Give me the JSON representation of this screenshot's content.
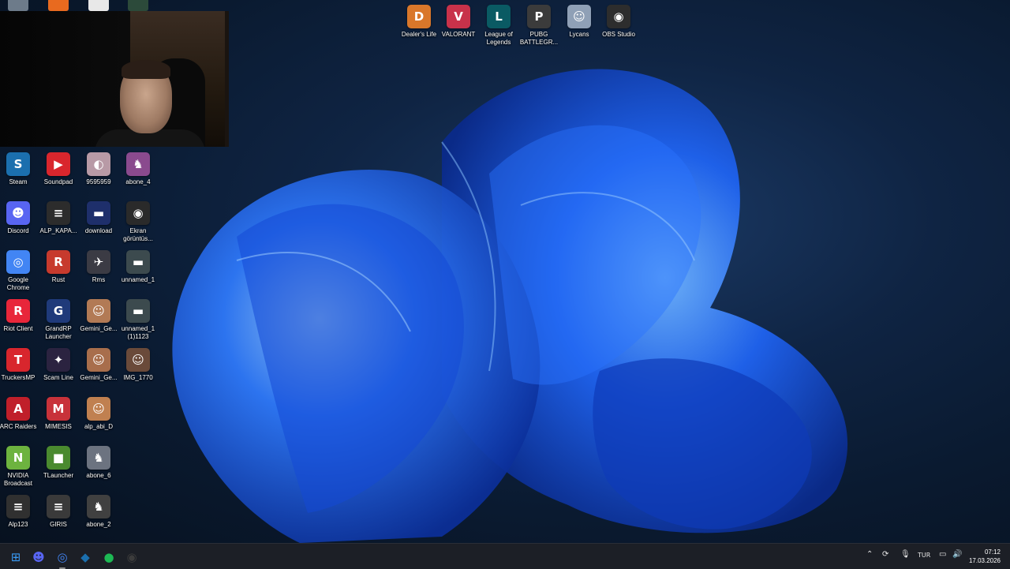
{
  "taskbar": {
    "language": "TUR",
    "time": "07:12",
    "date": "17.03.2026",
    "items": [
      {
        "name": "start-button",
        "icon": "windows-icon",
        "color": "#3a9bf5"
      },
      {
        "name": "discord-taskbar",
        "icon": "discord-icon",
        "color": "#5865f2"
      },
      {
        "name": "chrome-taskbar",
        "icon": "chrome-icon",
        "color": "#4285f4"
      },
      {
        "name": "steam-taskbar",
        "icon": "steam-icon",
        "color": "#1b6fae"
      },
      {
        "name": "spotify-taskbar",
        "icon": "spotify-icon",
        "color": "#1db954"
      },
      {
        "name": "obs-taskbar",
        "icon": "obs-icon",
        "color": "#3c3c3c"
      }
    ]
  },
  "top_icons": [
    {
      "label": "Dealer's Life",
      "icon": "dealers-life-icon",
      "color": "#d9772a",
      "glyph": "D"
    },
    {
      "label": "VALORANT",
      "icon": "valorant-icon",
      "color": "#c8324a",
      "glyph": "V"
    },
    {
      "label": "League of Legends",
      "icon": "league-icon",
      "color": "#0a5a63",
      "glyph": "L"
    },
    {
      "label": "PUBG BATTLEGR...",
      "icon": "pubg-icon",
      "color": "#3b3b3b",
      "glyph": "P"
    },
    {
      "label": "Lycans",
      "icon": "lycans-icon",
      "color": "#8fa0b6",
      "glyph": "☺"
    },
    {
      "label": "OBS Studio",
      "icon": "obs-icon",
      "color": "#2d2d2d",
      "glyph": "◉"
    }
  ],
  "desktop_columns": [
    [
      {
        "label": "Steam",
        "icon": "steam-icon",
        "color": "#1b6fae",
        "glyph": "S"
      },
      {
        "label": "Discord",
        "icon": "discord-icon",
        "color": "#5865f2",
        "glyph": "☻"
      },
      {
        "label": "Google Chrome",
        "icon": "chrome-icon",
        "color": "#4285f4",
        "glyph": "◎"
      },
      {
        "label": "Riot Client",
        "icon": "riot-icon",
        "color": "#e8263a",
        "glyph": "R"
      },
      {
        "label": "TruckersMP",
        "icon": "truckersmp-icon",
        "color": "#d8262d",
        "glyph": "T"
      },
      {
        "label": "ARC Raiders",
        "icon": "arc-raiders-icon",
        "color": "#c01f2a",
        "glyph": "A"
      },
      {
        "label": "NVIDIA Broadcast",
        "icon": "nvidia-icon",
        "color": "#6db33f",
        "glyph": "N"
      },
      {
        "label": "Alp123",
        "icon": "alp123-icon",
        "color": "#303030",
        "glyph": "≡"
      }
    ],
    [
      {
        "label": "Soundpad",
        "icon": "soundpad-icon",
        "color": "#d9262d",
        "glyph": "▶"
      },
      {
        "label": "ALP_KAPA...",
        "icon": "alp-kapa-icon",
        "color": "#2c2c2c",
        "glyph": "≡"
      },
      {
        "label": "Rust",
        "icon": "rust-icon",
        "color": "#c73a2d",
        "glyph": "R"
      },
      {
        "label": "GrandRP Launcher",
        "icon": "grandrp-icon",
        "color": "#1f3a7a",
        "glyph": "G"
      },
      {
        "label": "Scam Line",
        "icon": "scam-line-icon",
        "color": "#2b2340",
        "glyph": "✦"
      },
      {
        "label": "MIMESIS",
        "icon": "mimesis-icon",
        "color": "#c8323a",
        "glyph": "M"
      },
      {
        "label": "TLauncher",
        "icon": "tlauncher-icon",
        "color": "#4a8a2f",
        "glyph": "■"
      },
      {
        "label": "GIRIS",
        "icon": "giris-icon",
        "color": "#3a3a3a",
        "glyph": "≡"
      }
    ],
    [
      {
        "label": "9595959",
        "icon": "image-icon",
        "color": "#b89aa6",
        "glyph": "◐"
      },
      {
        "label": "download",
        "icon": "image-icon",
        "color": "#1e2f6b",
        "glyph": "▬"
      },
      {
        "label": "Rms",
        "icon": "rms-icon",
        "color": "#3b3b44",
        "glyph": "✈"
      },
      {
        "label": "Gemini_Ge...",
        "icon": "portrait-icon",
        "color": "#b27a55",
        "glyph": "☺"
      },
      {
        "label": "Gemini_Ge...",
        "icon": "portrait-icon",
        "color": "#a86e4c",
        "glyph": "☺"
      },
      {
        "label": "alp_abi_D",
        "icon": "portrait-icon",
        "color": "#c08050",
        "glyph": "☺"
      },
      {
        "label": "abone_6",
        "icon": "wolf-icon",
        "color": "#6c7380",
        "glyph": "♞"
      },
      {
        "label": "abone_2",
        "icon": "wolf-icon",
        "color": "#404040",
        "glyph": "♞"
      }
    ],
    [
      {
        "label": "abone_4",
        "icon": "wolf-icon",
        "color": "#8a4a8e",
        "glyph": "♞"
      },
      {
        "label": "Ekran görüntüs...",
        "icon": "screenshot-icon",
        "color": "#2a2a2a",
        "glyph": "◉"
      },
      {
        "label": "unnamed_1",
        "icon": "image-icon",
        "color": "#3c4a4e",
        "glyph": "▬"
      },
      {
        "label": "unnamed_1 (1)1123",
        "icon": "image-icon",
        "color": "#3c4a4e",
        "glyph": "▬"
      },
      {
        "label": "IMG_1770",
        "icon": "photo-icon",
        "color": "#6a4a3a",
        "glyph": "☺"
      }
    ]
  ]
}
